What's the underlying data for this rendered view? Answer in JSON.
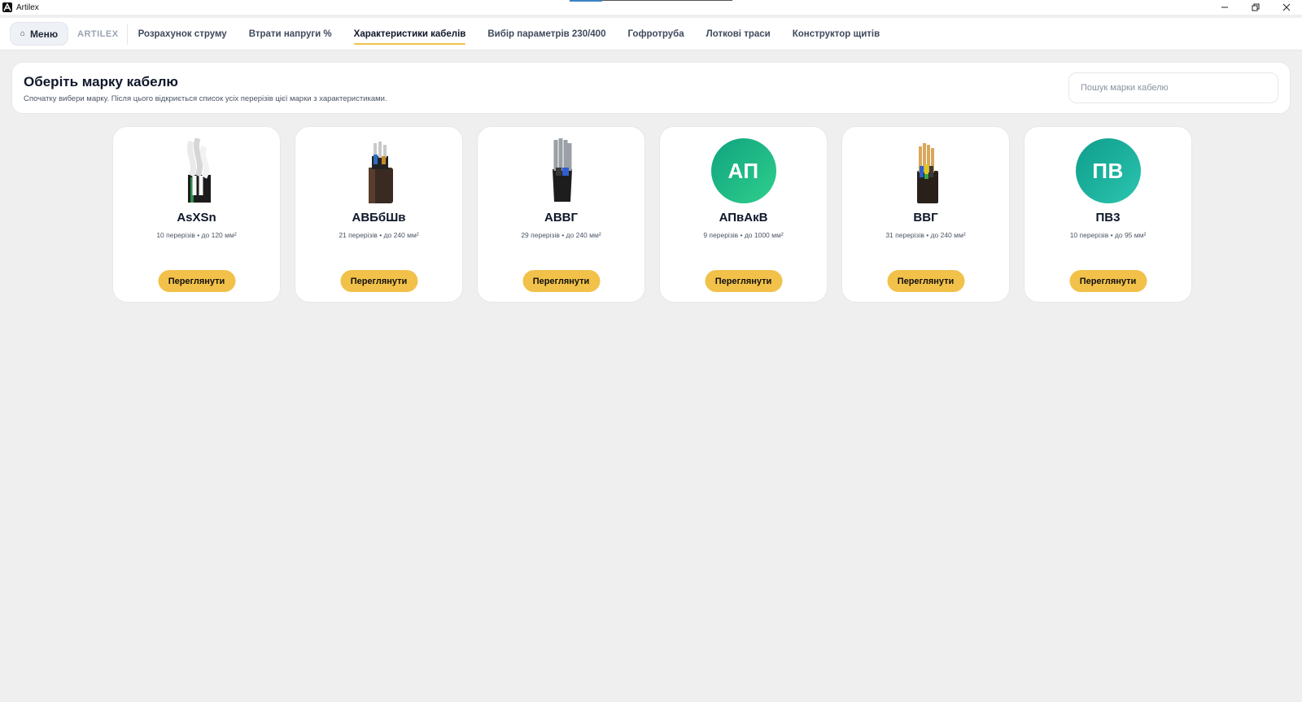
{
  "window": {
    "title": "Artilex"
  },
  "nav": {
    "menu_label": "Меню",
    "brand": "ARTILEX",
    "tabs": [
      {
        "label": "Розрахунок струму",
        "active": false
      },
      {
        "label": "Втрати напруги %",
        "active": false
      },
      {
        "label": "Характеристики кабелів",
        "active": true
      },
      {
        "label": "Вибір параметрів 230/400",
        "active": false
      },
      {
        "label": "Гофротруба",
        "active": false
      },
      {
        "label": "Лоткові траси",
        "active": false
      },
      {
        "label": "Конструктор щитів",
        "active": false
      }
    ]
  },
  "header": {
    "title": "Оберіть марку кабелю",
    "subtitle": "Спочатку вибери марку. Після цього відкриється список усіх перерізів цієї марки з характеристиками.",
    "search_placeholder": "Пошук марки кабелю"
  },
  "cards": [
    {
      "name": "AsXSn",
      "meta": "10 перерізів • до 120 мм²",
      "button": "Переглянути",
      "media": "cable-image-asxsn"
    },
    {
      "name": "АВБбШв",
      "meta": "21 перерізів • до 240 мм²",
      "button": "Переглянути",
      "media": "cable-image-avbbshv"
    },
    {
      "name": "АВВГ",
      "meta": "29 перерізів • до 240 мм²",
      "button": "Переглянути",
      "media": "cable-image-avvg"
    },
    {
      "name": "АПвАкВ",
      "meta": "9 перерізів • до 1000 мм²",
      "button": "Переглянути",
      "media": "badge",
      "badge_text": "АП",
      "badge_color_from": "#10a37f",
      "badge_color_to": "#2fcf8c"
    },
    {
      "name": "ВВГ",
      "meta": "31 перерізів • до 240 мм²",
      "button": "Переглянути",
      "media": "cable-image-vvg"
    },
    {
      "name": "ПВ3",
      "meta": "10 перерізів • до 95 мм²",
      "button": "Переглянути",
      "media": "badge",
      "badge_text": "ПВ",
      "badge_color_from": "#0e9e8a",
      "badge_color_to": "#2bc4b0"
    }
  ],
  "colors": {
    "accent": "#f2c14a",
    "background": "#efefef"
  }
}
